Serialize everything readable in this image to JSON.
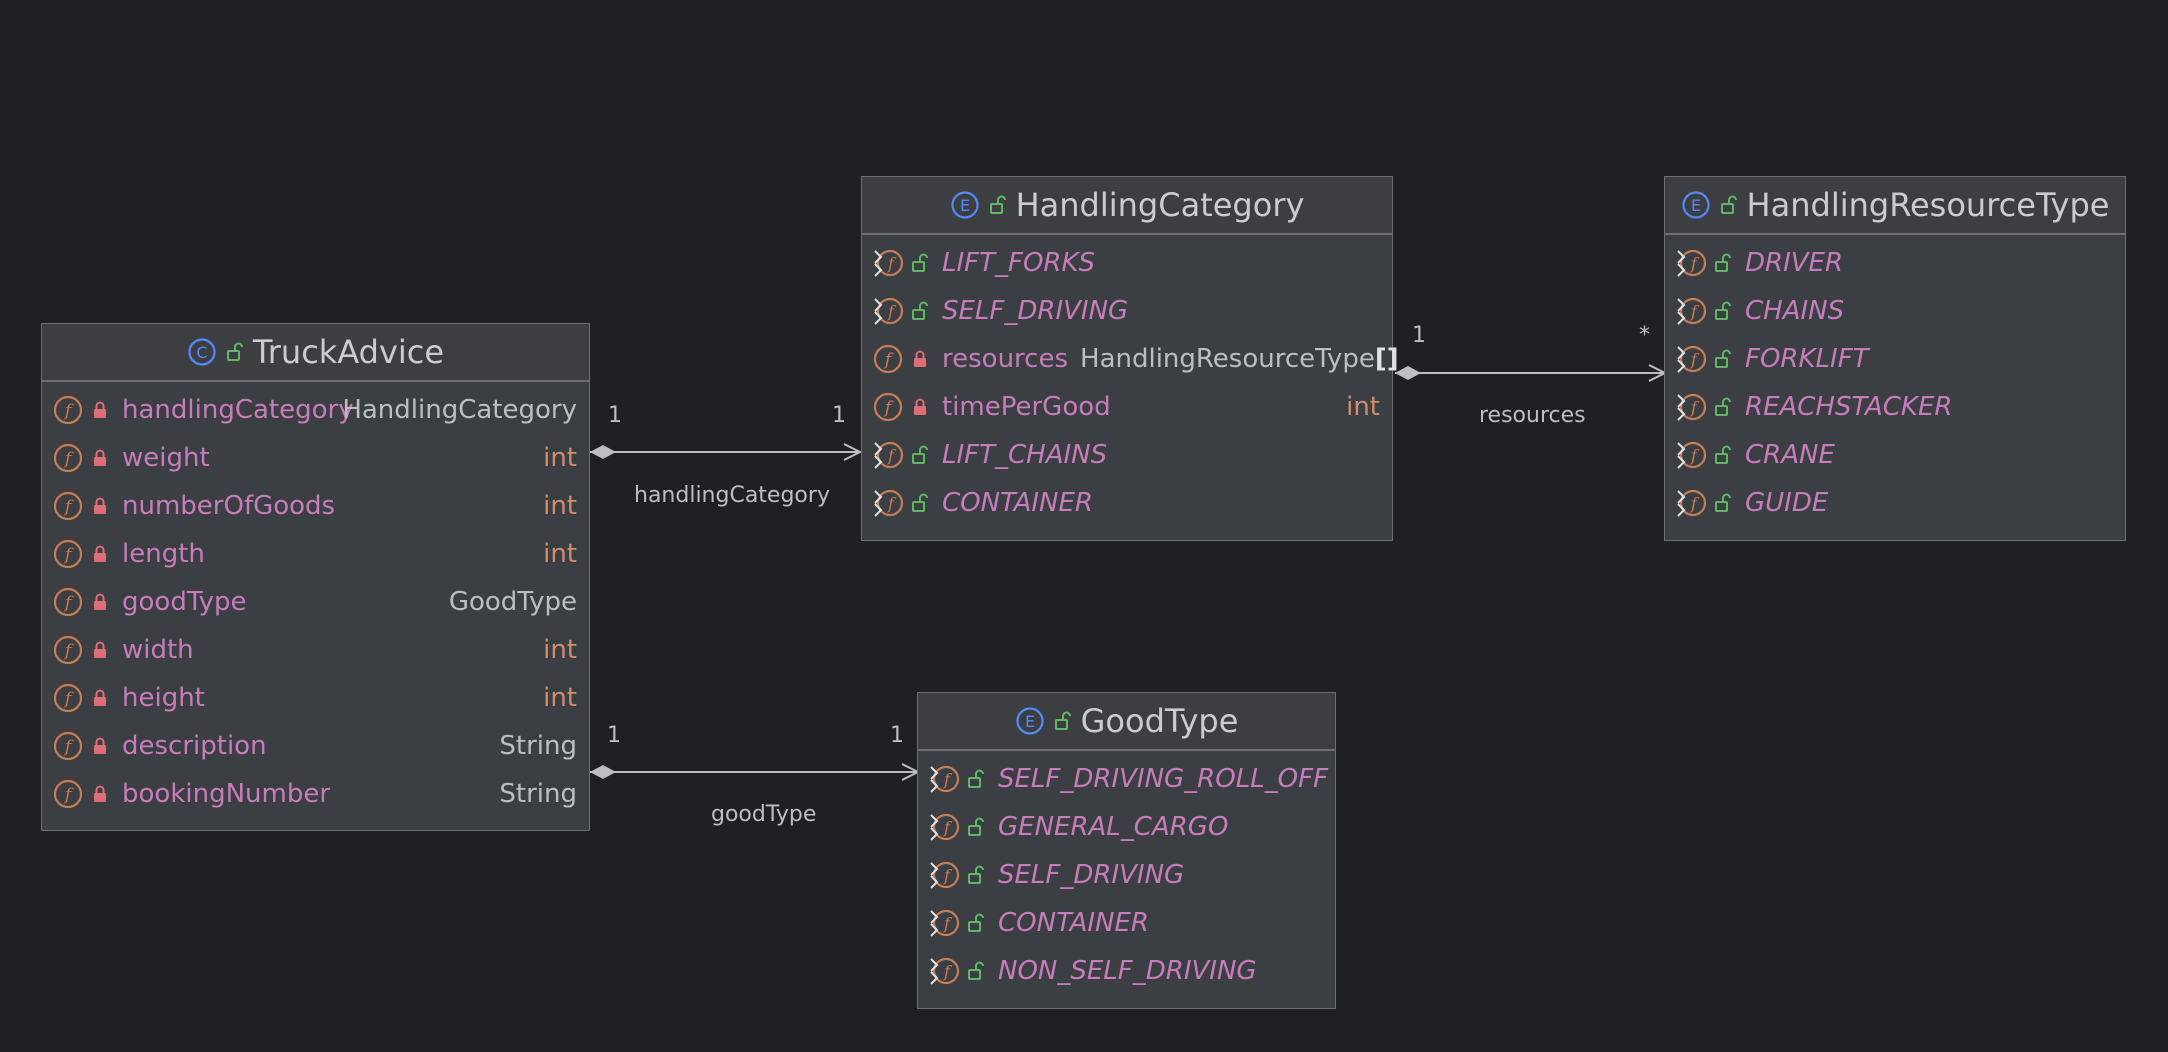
{
  "classes": {
    "truck_advice": {
      "kind": "C",
      "name": "TruckAdvice",
      "fields": [
        {
          "name": "handlingCategory",
          "type": "HandlingCategory"
        },
        {
          "name": "weight",
          "type": "int"
        },
        {
          "name": "numberOfGoods",
          "type": "int"
        },
        {
          "name": "length",
          "type": "int"
        },
        {
          "name": "goodType",
          "type": "GoodType"
        },
        {
          "name": "width",
          "type": "int"
        },
        {
          "name": "height",
          "type": "int"
        },
        {
          "name": "description",
          "type": "String"
        },
        {
          "name": "bookingNumber",
          "type": "String"
        }
      ]
    },
    "handling_category": {
      "kind": "E",
      "name": "HandlingCategory",
      "fields": [
        {
          "name": "LIFT_FORKS"
        },
        {
          "name": "SELF_DRIVING"
        },
        {
          "name": "resources",
          "type": "HandlingResourceType",
          "type_suffix": "[]"
        },
        {
          "name": "timePerGood",
          "type": "int"
        },
        {
          "name": "LIFT_CHAINS"
        },
        {
          "name": "CONTAINER"
        }
      ]
    },
    "handling_resource_type": {
      "kind": "E",
      "name": "HandlingResourceType",
      "fields": [
        {
          "name": "DRIVER"
        },
        {
          "name": "CHAINS"
        },
        {
          "name": "FORKLIFT"
        },
        {
          "name": "REACHSTACKER"
        },
        {
          "name": "CRANE"
        },
        {
          "name": "GUIDE"
        }
      ]
    },
    "good_type": {
      "kind": "E",
      "name": "GoodType",
      "fields": [
        {
          "name": "SELF_DRIVING_ROLL_OFF"
        },
        {
          "name": "GENERAL_CARGO"
        },
        {
          "name": "SELF_DRIVING"
        },
        {
          "name": "CONTAINER"
        },
        {
          "name": "NON_SELF_DRIVING"
        }
      ]
    }
  },
  "edges": {
    "handling_category": {
      "label": "handlingCategory",
      "source_mult": "1",
      "target_mult": "1"
    },
    "good_type": {
      "label": "goodType",
      "source_mult": "1",
      "target_mult": "1"
    },
    "resources": {
      "label": "resources",
      "source_mult": "1",
      "target_mult": "*"
    }
  },
  "icons": {
    "class_icon": "class-c-icon",
    "enum_icon": "enum-e-icon",
    "field_icon": "field-f-icon",
    "enum_constant_icon": "enum-constant-icon",
    "public_lock": "unlocked-icon",
    "private_lock": "locked-icon"
  },
  "colors": {
    "background": "#1f2024",
    "node_fill": "#3b3e42",
    "field_name": "#c77dbb",
    "primitive_type": "#cf8e6d",
    "ref_type": "#bcbec4",
    "class_icon": "#548af7",
    "public_lock": "#5fb865",
    "private_lock": "#e06c75",
    "field_icon": "#c77d55"
  }
}
